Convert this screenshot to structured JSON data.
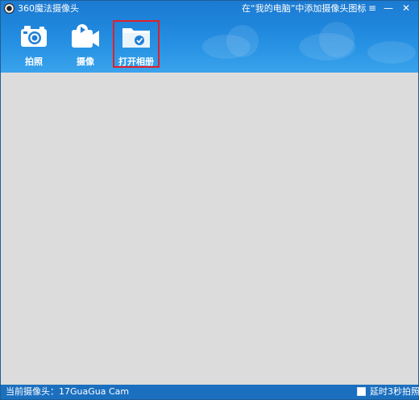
{
  "app": {
    "title": "360魔法摄像头",
    "hint": "在“我的电脑”中添加摄像头图标"
  },
  "window_controls": {
    "menu": "≡",
    "minimize": "—",
    "close": "✕"
  },
  "toolbar": {
    "photo_label": "拍照",
    "video_label": "摄像",
    "album_label": "打开相册"
  },
  "status": {
    "camera_text": "当前摄像头：17GuaGua Cam",
    "delay_label": "延时3秒拍照",
    "delay_checked": false
  },
  "colors": {
    "header": "#1f86dc",
    "statusbar": "#1b6fbf",
    "preview_bg": "#dcdcdc",
    "highlight": "#e0202a"
  }
}
